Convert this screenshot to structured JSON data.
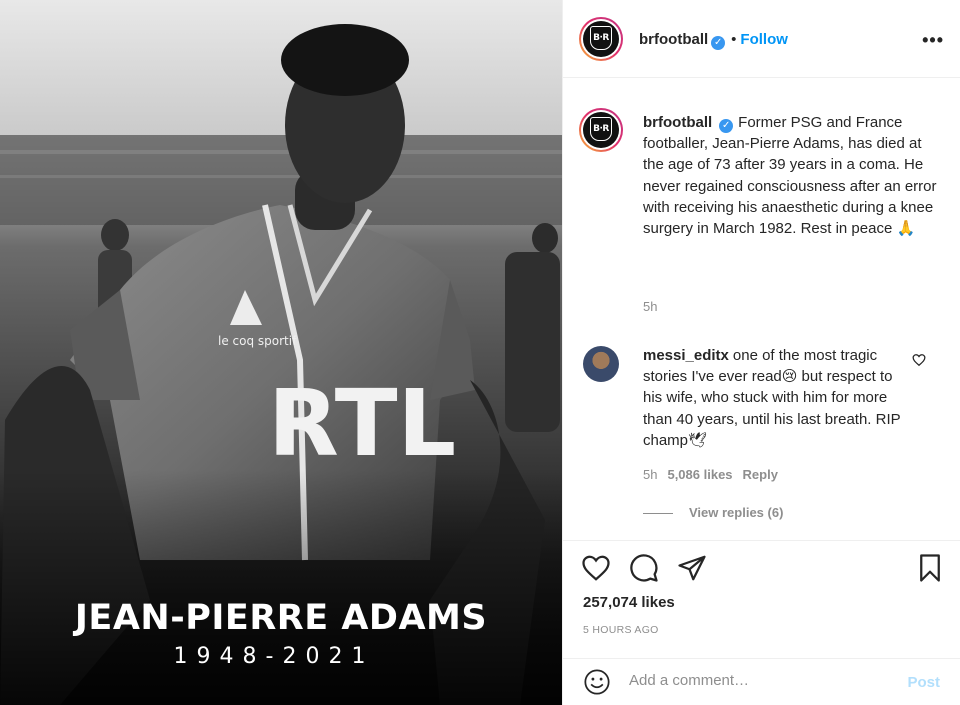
{
  "photo": {
    "name_overlay": "JEAN-PIERRE ADAMS",
    "years_overlay": "1948-2021",
    "shirt_brand": "le coq sportif",
    "shirt_sponsor": "RTL"
  },
  "header": {
    "username": "brfootball",
    "separator": "•",
    "follow_label": "Follow",
    "more_label": "•••"
  },
  "caption": {
    "username": "brfootball",
    "text": "Former PSG and France footballer, Jean-Pierre Adams, has died at the age of 73 after 39 years in a coma. He never regained consciousness after an error with receiving his anaesthetic during a knee surgery in March 1982. Rest in peace 🙏",
    "age": "5h"
  },
  "comment": {
    "username": "messi_editx",
    "text": "one of the most tragic stories I've ever read😢 but respect to his wife, who stuck with him for more than 40 years, until his last breath. RIP champ🕊",
    "age": "5h",
    "likes": "5,086 likes",
    "reply_label": "Reply",
    "view_replies": "View replies (6)"
  },
  "post": {
    "likes": "257,074 likes",
    "time": "5 HOURS AGO"
  },
  "add_comment": {
    "placeholder": "Add a comment…",
    "post_label": "Post"
  },
  "icons": {
    "verified": "verified-badge-icon",
    "heart": "heart-icon",
    "comment": "comment-icon",
    "share": "share-icon",
    "bookmark": "bookmark-icon",
    "emoji": "emoji-icon"
  },
  "colors": {
    "accent": "#0095f6",
    "verified": "#3897f0",
    "muted": "#8e8e8e",
    "post_disabled": "#b2dffc"
  }
}
